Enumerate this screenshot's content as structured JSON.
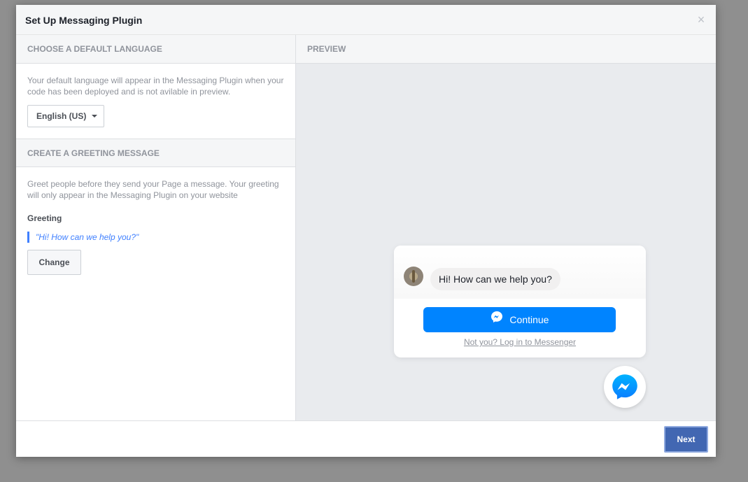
{
  "dialog": {
    "title": "Set Up Messaging Plugin",
    "close_glyph": "×"
  },
  "language_section": {
    "heading": "CHOOSE A DEFAULT LANGUAGE",
    "description": "Your default language will appear in the Messaging Plugin when your code has been deployed and is not avilable in preview.",
    "selected_language": "English (US)"
  },
  "greeting_section": {
    "heading": "CREATE A GREETING MESSAGE",
    "description": "Greet people before they send your Page a message. Your greeting will only appear in the Messaging Plugin on your website",
    "label": "Greeting",
    "quote": "\"Hi! How can we help you?\"",
    "change_label": "Change"
  },
  "preview": {
    "heading": "PREVIEW",
    "bubble_text": "Hi! How can we help you?",
    "continue_label": "Continue",
    "login_link": "Not you? Log in to Messenger",
    "accent_color": "#0084ff"
  },
  "footer": {
    "next_label": "Next"
  }
}
